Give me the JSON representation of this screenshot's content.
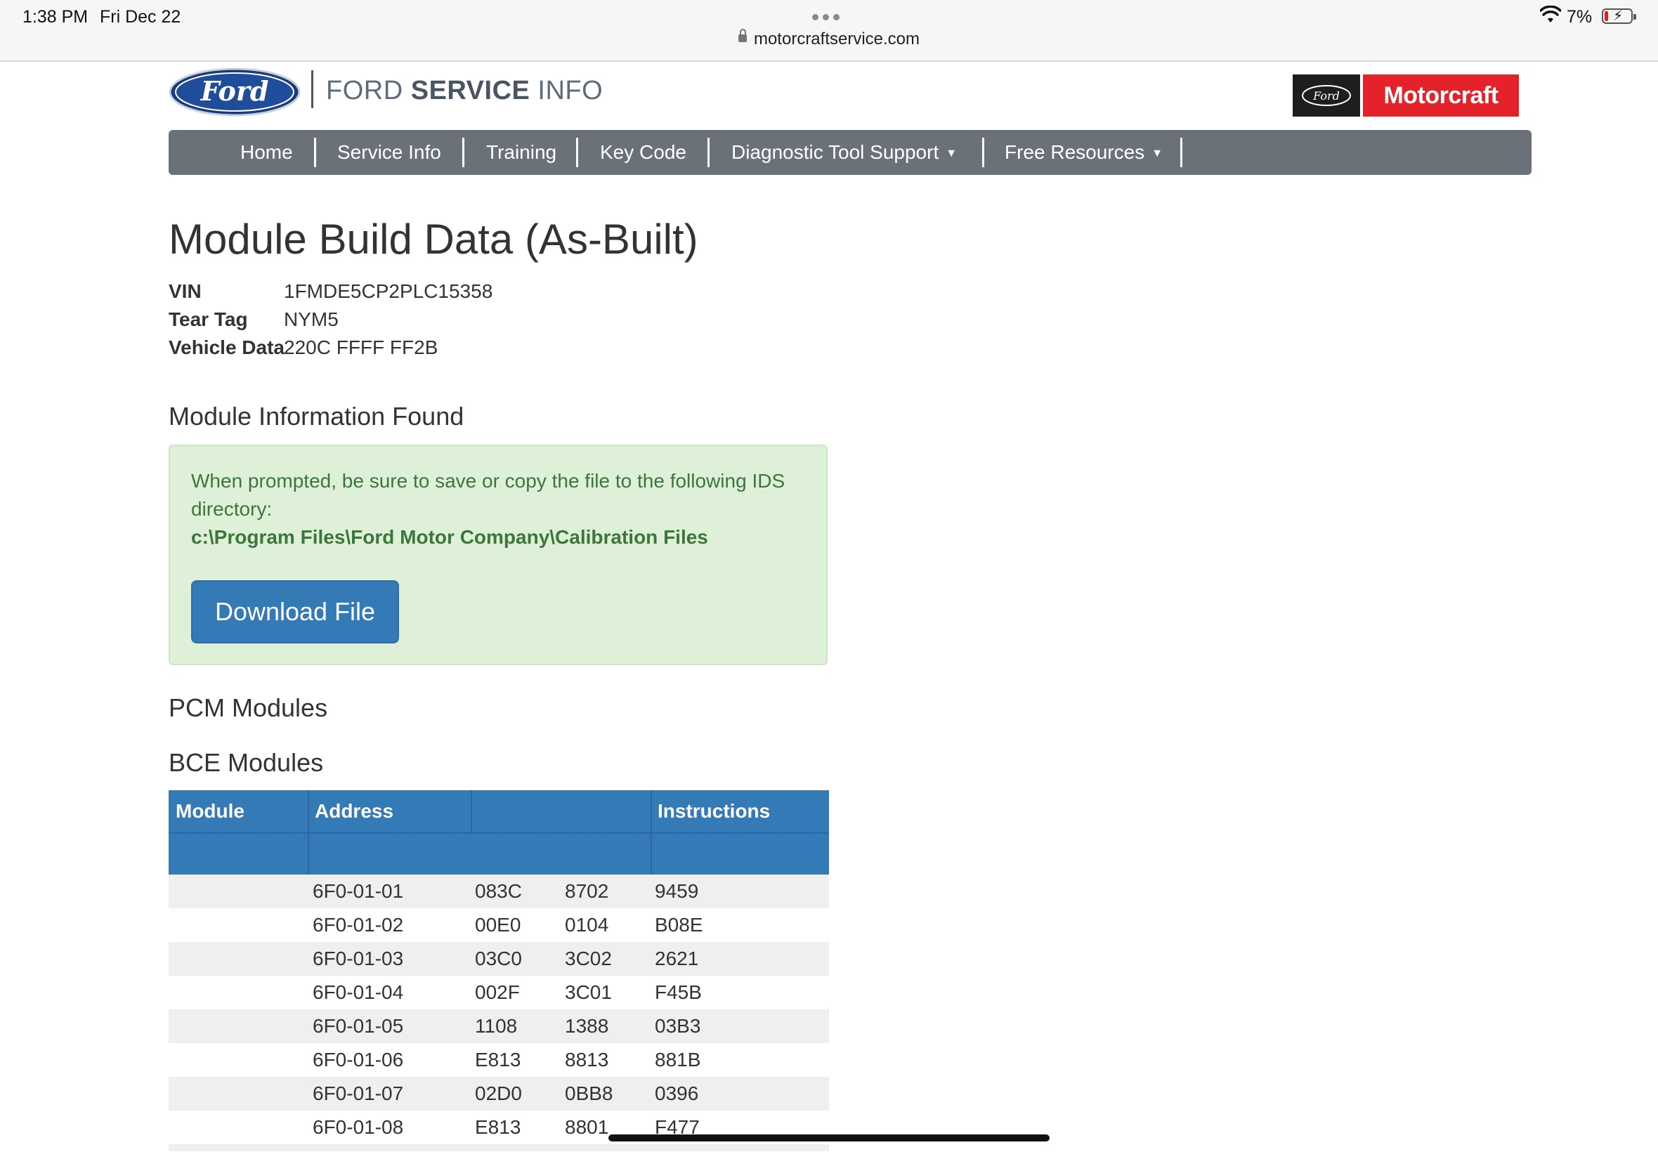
{
  "status_bar": {
    "time": "1:38 PM",
    "date": "Fri Dec 22",
    "url": "motorcraftservice.com",
    "battery_percent": "7%",
    "battery_level": 0.07,
    "icons": [
      "more-dots-icon",
      "lock-icon",
      "wifi-icon",
      "battery-charging-icon"
    ]
  },
  "header": {
    "ford_logo_text": "Ford",
    "site_title_light": "FORD ",
    "site_title_bold": "SERVICE",
    "site_title_end": " INFO",
    "motorcraft_ford_text": "Ford",
    "motorcraft_text": "Motorcraft"
  },
  "nav": {
    "items": [
      {
        "label": "Home"
      },
      {
        "label": "Service Info"
      },
      {
        "label": "Training"
      },
      {
        "label": "Key Code"
      },
      {
        "label": "Diagnostic Tool Support",
        "has_dropdown": true
      },
      {
        "label": "Free Resources",
        "has_dropdown": true
      }
    ],
    "caret": "▼"
  },
  "page": {
    "title": "Module Build Data (As-Built)",
    "vin_label": "VIN",
    "vin_value": "1FMDE5CP2PLC15358",
    "tear_tag_label": "Tear Tag",
    "tear_tag_value": "NYM5",
    "vehicle_data_label": "Vehicle Data",
    "vehicle_data_value": "220C FFFF FF2B",
    "section_module_info": "Module Information Found",
    "alert_text": "When prompted, be sure to save or copy the file to the following IDS directory:",
    "alert_path": "c:\\Program Files\\Ford Motor Company\\Calibration Files",
    "download_button": "Download File",
    "section_pcm": "PCM Modules",
    "section_bce": "BCE Modules"
  },
  "colors": {
    "nav_bg": "#6b7178",
    "table_header": "#337ab7",
    "button": "#337ab7",
    "alert_bg": "#dff0d8",
    "alert_text": "#3c763d",
    "motorcraft_red": "#e32229"
  },
  "table": {
    "headers": [
      "Module",
      "Address",
      "",
      "Instructions"
    ],
    "rows": [
      {
        "module": "",
        "address": "6F0-01-01",
        "c1": "083C",
        "c2": "8702",
        "c3": "9459"
      },
      {
        "module": "",
        "address": "6F0-01-02",
        "c1": "00E0",
        "c2": "0104",
        "c3": "B08E"
      },
      {
        "module": "",
        "address": "6F0-01-03",
        "c1": "03C0",
        "c2": "3C02",
        "c3": "2621"
      },
      {
        "module": "",
        "address": "6F0-01-04",
        "c1": "002F",
        "c2": "3C01",
        "c3": "F45B"
      },
      {
        "module": "",
        "address": "6F0-01-05",
        "c1": "1108",
        "c2": "1388",
        "c3": "03B3"
      },
      {
        "module": "",
        "address": "6F0-01-06",
        "c1": "E813",
        "c2": "8813",
        "c3": "881B"
      },
      {
        "module": "",
        "address": "6F0-01-07",
        "c1": "02D0",
        "c2": "0BB8",
        "c3": "0396"
      },
      {
        "module": "",
        "address": "6F0-01-08",
        "c1": "E813",
        "c2": "8801",
        "c3": "F477"
      }
    ]
  }
}
